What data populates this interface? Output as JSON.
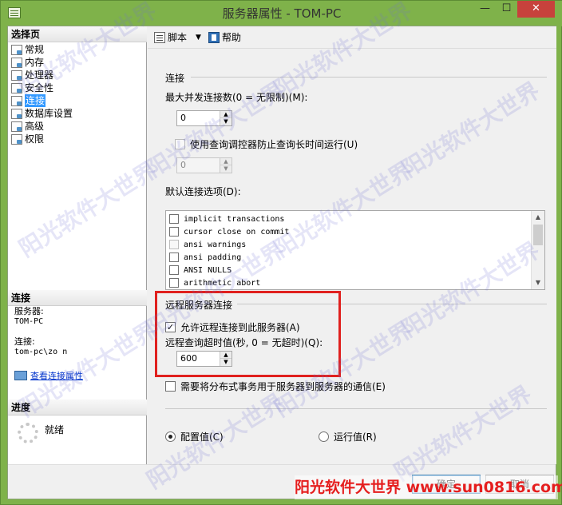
{
  "window": {
    "title": "服务器属性 - TOM-PC",
    "minimize": "—",
    "maximize": "☐",
    "close": "✕"
  },
  "left_pane": {
    "select_page_header": "选择页",
    "nav_items": [
      {
        "label": "常规"
      },
      {
        "label": "内存"
      },
      {
        "label": "处理器"
      },
      {
        "label": "安全性"
      },
      {
        "label": "连接"
      },
      {
        "label": "数据库设置"
      },
      {
        "label": "高级"
      },
      {
        "label": "权限"
      }
    ],
    "selected_index": 4,
    "connection_header": "连接",
    "server_label": "服务器:",
    "server_value": "TOM-PC",
    "connection_label": "连接:",
    "connection_value": "tom-pc\\zo      n",
    "view_link": "查看连接属性",
    "progress_header": "进度",
    "progress_status": "就绪"
  },
  "toolbar": {
    "script_label": "脚本",
    "arrow": "▼",
    "help_label": "帮助"
  },
  "connections": {
    "section_title": "连接",
    "max_concurrent_label": "最大并发连接数(0 = 无限制)(M):",
    "max_concurrent_value": "0",
    "governor_checkbox_label": "使用查询调控器防止查询长时间运行(U)",
    "governor_checked": false,
    "governor_value": "0",
    "default_options_label": "默认连接选项(D):",
    "options": [
      {
        "label": "implicit transactions",
        "checked": false
      },
      {
        "label": "cursor close on commit",
        "checked": false
      },
      {
        "label": "ansi warnings",
        "checked": false
      },
      {
        "label": "ansi padding",
        "checked": false
      },
      {
        "label": "ANSI NULLS",
        "checked": false
      },
      {
        "label": "arithmetic abort",
        "checked": false
      }
    ]
  },
  "remote": {
    "section_title": "远程服务器连接",
    "allow_remote_label": "允许远程连接到此服务器(A)",
    "allow_remote_checked": true,
    "timeout_label": "远程查询超时值(秒, 0 = 无超时)(Q):",
    "timeout_value": "600",
    "distributed_label": "需要将分布式事务用于服务器到服务器的通信(E)",
    "distributed_checked": false
  },
  "value_mode": {
    "configured_label": "配置值(C)",
    "running_label": "运行值(R)",
    "selected": "configured"
  },
  "footer": {
    "ok_label": "确定",
    "cancel_label": "取消"
  },
  "watermarks": {
    "repeat_text": "阳光软件大世界",
    "banner_text": "阳光软件大世界 www.sun0816.com"
  },
  "colors": {
    "window_frame": "#7fb24a",
    "close_button": "#c7423c",
    "selection": "#3399ff",
    "highlight_box": "#e0201e",
    "link": "#0033cc"
  }
}
